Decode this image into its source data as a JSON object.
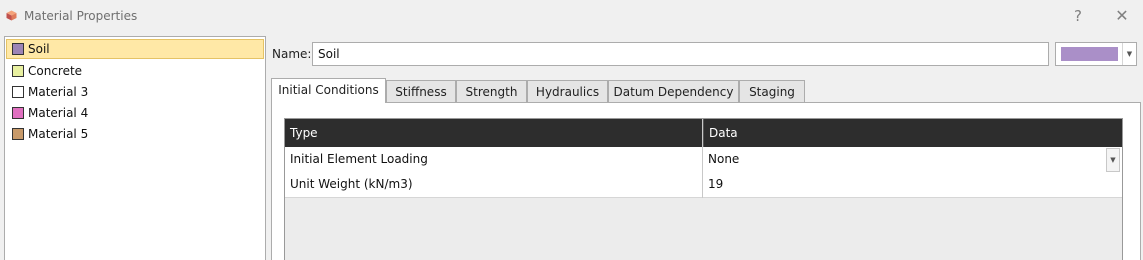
{
  "window": {
    "title": "Material Properties",
    "help_label": "?",
    "close_label": "✕"
  },
  "materials": [
    {
      "label": "Soil",
      "color": "#9d84b6",
      "selected": true
    },
    {
      "label": "Concrete",
      "color": "#e8f0a0",
      "selected": false
    },
    {
      "label": "Material 3",
      "color": "#ffffff",
      "selected": false
    },
    {
      "label": "Material 4",
      "color": "#e070c0",
      "selected": false
    },
    {
      "label": "Material 5",
      "color": "#c89a6a",
      "selected": false
    }
  ],
  "name_field": {
    "label": "Name:",
    "value": "Soil",
    "color": "#aa8fc8"
  },
  "tabs": [
    {
      "label": "Initial Conditions",
      "active": true
    },
    {
      "label": "Stiffness",
      "active": false
    },
    {
      "label": "Strength",
      "active": false
    },
    {
      "label": "Hydraulics",
      "active": false
    },
    {
      "label": "Datum Dependency",
      "active": false
    },
    {
      "label": "Staging",
      "active": false
    }
  ],
  "table": {
    "headers": [
      "Type",
      "Data"
    ],
    "rows": [
      {
        "type": "Initial Element Loading",
        "data": "None",
        "dropdown": true
      },
      {
        "type": "Unit Weight (kN/m3)",
        "data": "19",
        "dropdown": false
      }
    ]
  }
}
